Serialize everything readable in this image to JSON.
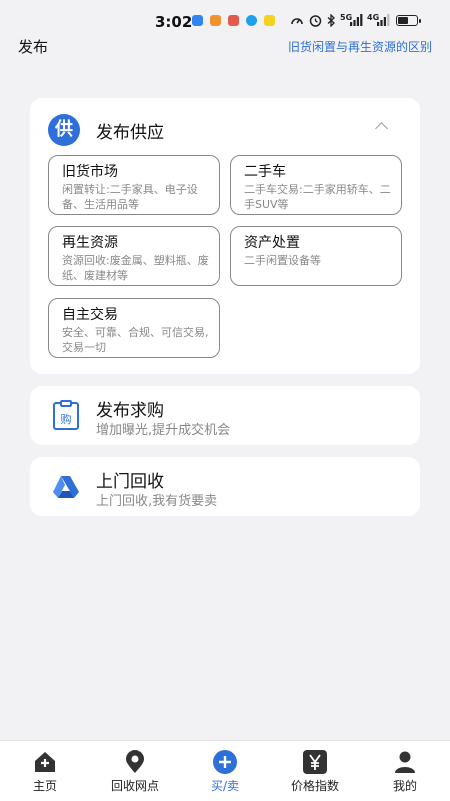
{
  "status_bar": {
    "time": "3:02",
    "icons": [
      "app-icon-blue",
      "app-icon-orange",
      "app-icon-red",
      "app-icon-blue2",
      "app-icon-yellow",
      "speed-icon",
      "alarm-icon",
      "bluetooth-icon",
      "signal-5g-icon",
      "signal-4g-icon",
      "battery-icon"
    ],
    "network_1": "5G",
    "network_2": "4G",
    "battery_level": 0.6
  },
  "header": {
    "title": "发布",
    "link": "旧货闲置与再生资源的区别"
  },
  "supply": {
    "badge": "供",
    "title": "发布供应",
    "options": [
      {
        "title": "旧货市场",
        "desc": "闲置转让:二手家具、电子设备、生活用品等"
      },
      {
        "title": "二手车",
        "desc": "二手车交易:二手家用轿车、二手SUV等"
      },
      {
        "title": "再生资源",
        "desc": "资源回收:废金属、塑料瓶、废纸、废建材等"
      },
      {
        "title": "资产处置",
        "desc": "二手闲置设备等"
      },
      {
        "title": "自主交易",
        "desc": "安全、可靠、合规、可信交易,交易一切"
      }
    ]
  },
  "purchase": {
    "title": "发布求购",
    "desc": "增加曝光,提升成交机会",
    "icon_text": "购"
  },
  "recycle": {
    "title": "上门回收",
    "desc": "上门回收,我有货要卖"
  },
  "nav": {
    "items": [
      {
        "label": "主页",
        "icon": "home-icon"
      },
      {
        "label": "回收网点",
        "icon": "location-icon"
      },
      {
        "label": "买/卖",
        "icon": "plus-icon"
      },
      {
        "label": "价格指数",
        "icon": "yen-icon"
      },
      {
        "label": "我的",
        "icon": "user-icon"
      }
    ],
    "active_index": 2
  },
  "colors": {
    "accent": "#2f6fd8",
    "background": "#f2f2f4",
    "card": "#ffffff",
    "muted_text": "#888888"
  }
}
